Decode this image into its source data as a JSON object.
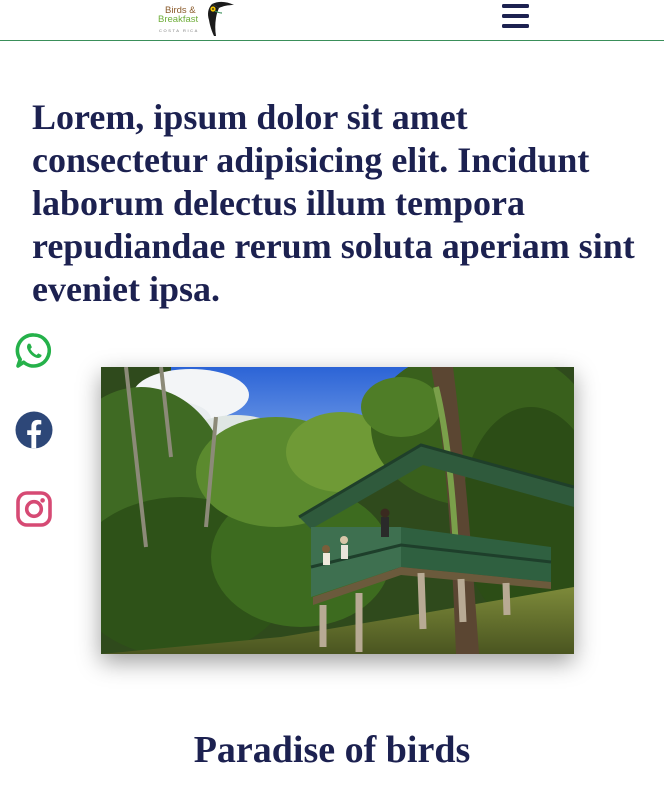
{
  "header": {
    "logo": {
      "line1": "Birds &",
      "line2": "Breakfast",
      "tagline": "COSTA RICA"
    },
    "menu_icon": "hamburger-menu-icon"
  },
  "intro": {
    "text": "Lorem, ipsum dolor sit amet consectetur adipisicing elit. Incidunt laborum delectus illum tempora repudiandae rerum soluta aperiam sint eveniet ipsa."
  },
  "social": [
    {
      "name": "whatsapp",
      "icon": "whatsapp-icon",
      "color": "#25b14a"
    },
    {
      "name": "facebook",
      "icon": "facebook-icon",
      "color": "#2d4778"
    },
    {
      "name": "instagram",
      "icon": "instagram-icon",
      "color": "#d64a74"
    }
  ],
  "colors": {
    "heading": "#1c2150",
    "header_border": "#3a8f5a"
  },
  "section": {
    "title": "Paradise of birds"
  }
}
